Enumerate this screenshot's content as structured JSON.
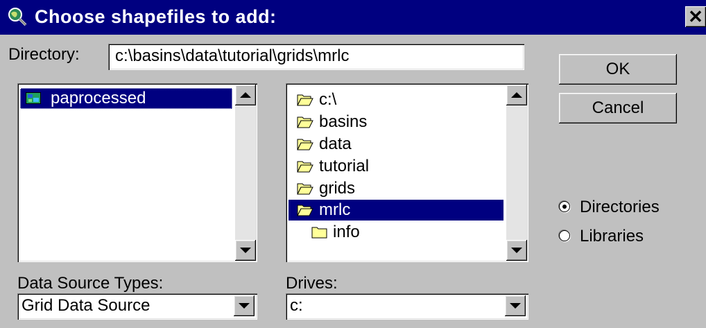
{
  "window": {
    "title": "Choose shapefiles to add:",
    "close_glyph": "✕"
  },
  "directory": {
    "label": "Directory:",
    "value": "c:\\basins\\data\\tutorial\\grids\\mrlc"
  },
  "buttons": {
    "ok": "OK",
    "cancel": "Cancel"
  },
  "files": {
    "items": [
      {
        "label": "paprocessed",
        "icon": "grid-layer-icon",
        "selected": true
      }
    ]
  },
  "folders": {
    "items": [
      {
        "label": "c:\\",
        "icon": "open-folder-icon",
        "selected": false
      },
      {
        "label": "basins",
        "icon": "open-folder-icon",
        "selected": false
      },
      {
        "label": "data",
        "icon": "open-folder-icon",
        "selected": false
      },
      {
        "label": "tutorial",
        "icon": "open-folder-icon",
        "selected": false
      },
      {
        "label": "grids",
        "icon": "open-folder-icon",
        "selected": false
      },
      {
        "label": "mrlc",
        "icon": "open-folder-icon",
        "selected": true
      },
      {
        "label": "info",
        "icon": "closed-folder-icon",
        "selected": false
      }
    ]
  },
  "radios": {
    "directories": {
      "label": "Directories",
      "checked": true
    },
    "libraries": {
      "label": "Libraries",
      "checked": false
    }
  },
  "data_source": {
    "label": "Data Source Types:",
    "value": "Grid Data Source"
  },
  "drives": {
    "label": "Drives:",
    "value": "c:"
  },
  "colors": {
    "title_bar": "#000080",
    "selection": "#000080",
    "face": "#c0c0c0",
    "folder": "#ffff99"
  }
}
